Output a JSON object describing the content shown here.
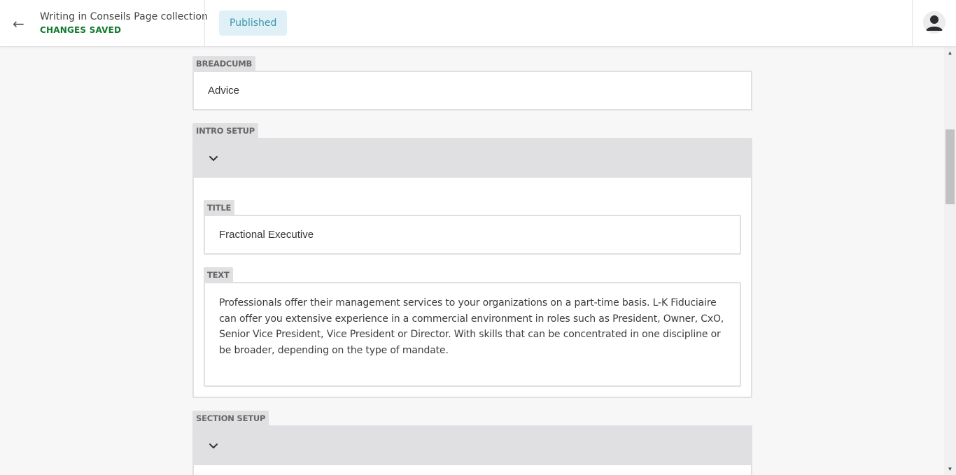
{
  "header": {
    "back_icon": "arrow-left-icon",
    "title": "Writing in Conseils Page collection",
    "save_status": "CHANGES SAVED",
    "status_badge": "Published",
    "avatar_icon": "user-avatar-icon"
  },
  "breadcrumb": {
    "label": "BREADCUMB",
    "value": "Advice"
  },
  "intro_setup": {
    "label": "INTRO SETUP",
    "toggle_icon": "chevron-down-icon",
    "title": {
      "label": "TITLE",
      "value": "Fractional Executive"
    },
    "text": {
      "label": "TEXT",
      "value": "Professionals offer their management services to your organizations on a part-time basis. L-K Fiduciaire can offer you extensive experience in a commercial environment in roles such as President, Owner, CxO, Senior Vice President, Vice President or Director. With skills that can be concentrated in one discipline or be broader, depending on the type of mandate."
    }
  },
  "section_setup": {
    "label": "SECTION SETUP",
    "toggle_icon": "chevron-down-icon"
  },
  "colors": {
    "saved_green": "#117a2e",
    "badge_bg": "#dff1f6",
    "badge_text": "#3a95ad",
    "label_bg": "#e0e0e3"
  }
}
